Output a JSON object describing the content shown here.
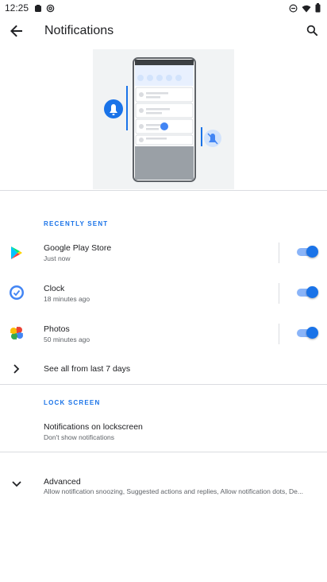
{
  "status_bar": {
    "time": "12:25",
    "left_icons": [
      "media-icon",
      "at-sign-icon"
    ],
    "right_icons": [
      "dnd-icon",
      "wifi-icon",
      "battery-icon"
    ]
  },
  "header": {
    "title": "Notifications"
  },
  "recently_sent": {
    "header": "RECENTLY SENT",
    "apps": [
      {
        "name": "Google Play Store",
        "time": "Just now",
        "enabled": true,
        "icon": "play-store-icon"
      },
      {
        "name": "Clock",
        "time": "18 minutes ago",
        "enabled": true,
        "icon": "clock-icon"
      },
      {
        "name": "Photos",
        "time": "50 minutes ago",
        "enabled": true,
        "icon": "photos-icon"
      }
    ],
    "see_all_label": "See all from last 7 days"
  },
  "lock_screen": {
    "header": "LOCK SCREEN",
    "item_title": "Notifications on lockscreen",
    "item_sub": "Don't show notifications"
  },
  "advanced": {
    "title": "Advanced",
    "sub": "Allow notification snoozing, Suggested actions and replies, Allow notification dots, De..."
  },
  "colors": {
    "accent": "#1a73e8",
    "switch_track": "#8ab4f8",
    "divider": "#dadce0"
  }
}
